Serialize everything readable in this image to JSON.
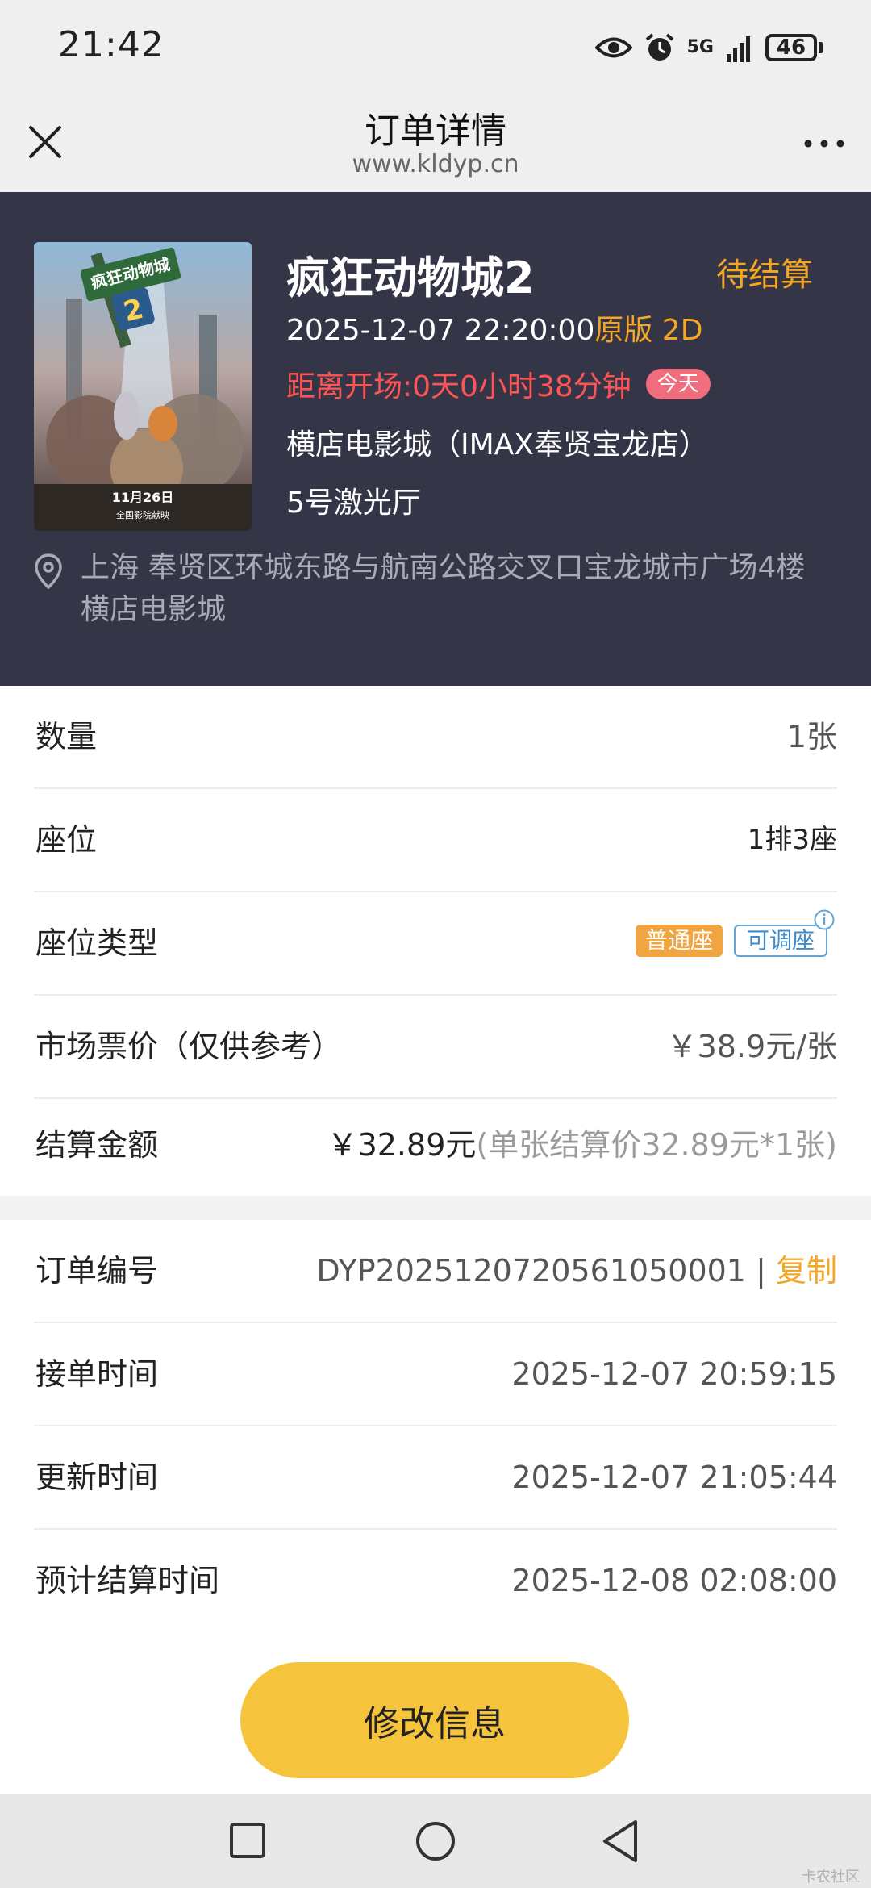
{
  "status_bar": {
    "time": "21:42",
    "network_label": "5G",
    "battery_level": "46"
  },
  "nav": {
    "title": "订单详情",
    "url": "www.kldyp.cn"
  },
  "movie": {
    "title": "疯狂动物城2",
    "status": "待结算",
    "showtime": "2025-12-07 22:20:00",
    "version": "原版 2D",
    "countdown": "距离开场:0天0小时38分钟",
    "today_badge": "今天",
    "cinema": "横店电影城（IMAX奉贤宝龙店）",
    "hall": "5号激光厅",
    "address": "上海  奉贤区环城东路与航南公路交叉口宝龙城市广场4楼横店电影城",
    "poster": {
      "title_text": "疯狂动物城",
      "number": "2",
      "date_text": "11月26日",
      "release_text": "全国影院献映"
    }
  },
  "ticket_info": {
    "quantity_label": "数量",
    "quantity_value": "1张",
    "seat_label": "座位",
    "seat_value": "1排3座",
    "seat_type_label": "座位类型",
    "seat_type_tag": "普通座",
    "seat_adjust_tag": "可调座",
    "market_price_label": "市场票价（仅供参考）",
    "market_price_value": "￥38.9元/张",
    "settlement_label": "结算金额",
    "settlement_value": "￥32.89元",
    "settlement_detail": "(单张结算价32.89元*1张)"
  },
  "order_info": {
    "order_no_label": "订单编号",
    "order_no_value": "DYP202512072056105000​1",
    "separator": "|",
    "copy_label": "复制",
    "accept_time_label": "接单时间",
    "accept_time_value": "2025-12-07 20:59:15",
    "update_time_label": "更新时间",
    "update_time_value": "2025-12-07 21:05:44",
    "settle_time_label": "预计结算时间",
    "settle_time_value": "2025-12-08 02:08:00"
  },
  "actions": {
    "modify_label": "修改信息"
  },
  "watermark": "卡农社区",
  "colors": {
    "header_bg": "#353548",
    "accent_orange": "#f5a623",
    "countdown_red": "#ff5454",
    "button_yellow": "#f6c33d",
    "tag_blue": "#3d8ccc"
  },
  "icons": [
    "eye-icon",
    "alarm-icon",
    "signal-icon",
    "battery-icon",
    "close-icon",
    "more-icon",
    "location-pin-icon",
    "info-icon",
    "recent-apps-icon",
    "home-icon",
    "back-icon"
  ]
}
